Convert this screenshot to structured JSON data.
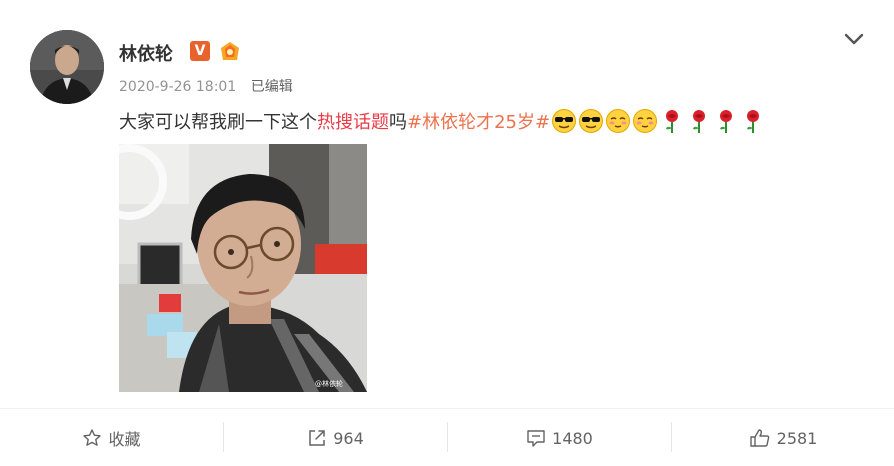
{
  "post": {
    "author": "林依轮",
    "timestamp": "2020-9-26 18:01",
    "edited_label": "已编辑",
    "text_prefix": "大家可以帮我刷一下这个",
    "hot_search": "热搜话题",
    "text_mid": "吗",
    "hashtag": "#林依轮才25岁#",
    "photo_watermark": "@林依轮",
    "emojis": [
      "cool-face",
      "cool-face",
      "smug-face",
      "smug-face",
      "rose",
      "rose",
      "rose",
      "rose"
    ]
  },
  "actions": {
    "favorite_label": "收藏",
    "repost_count": "964",
    "comment_count": "1480",
    "like_count": "2581"
  },
  "colors": {
    "hot_search": "#eb3b46",
    "hashtag": "#eb7350",
    "verified_badge": "#e8622e"
  }
}
